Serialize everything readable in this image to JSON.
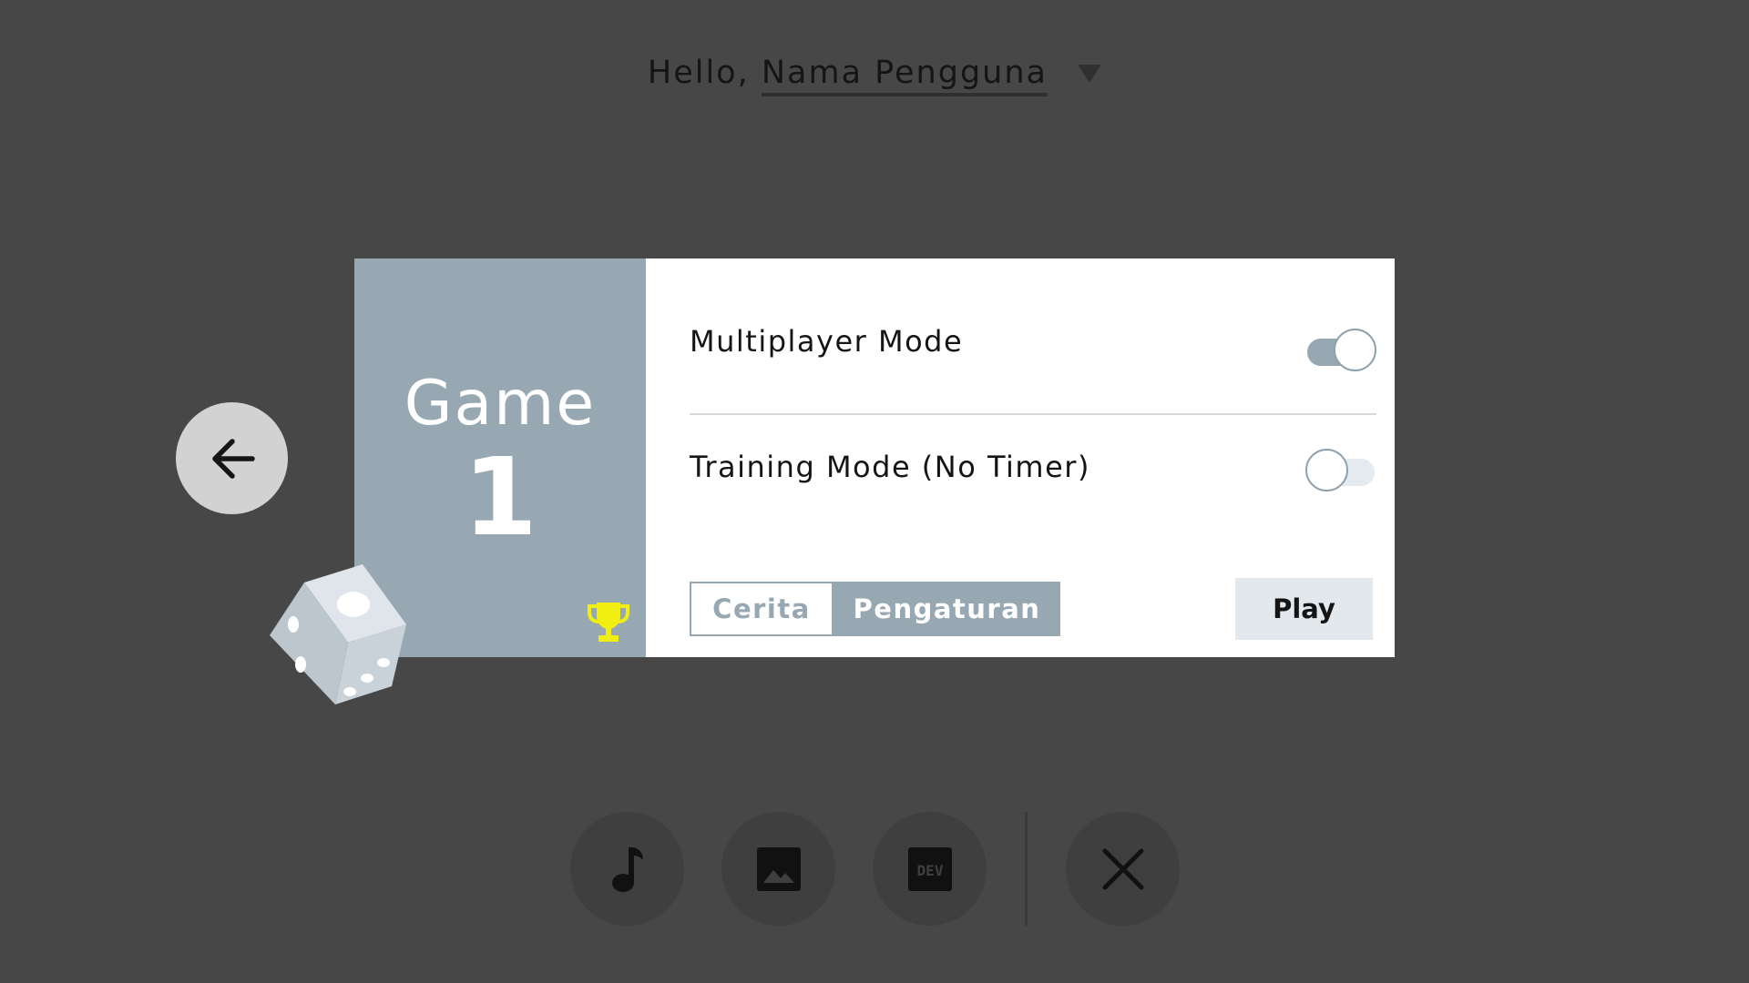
{
  "header": {
    "greeting_prefix": "Hello,",
    "username": "Nama Pengguna"
  },
  "game_card": {
    "title": "Game",
    "number": "1",
    "settings": [
      {
        "label": "Multiplayer Mode",
        "enabled": true
      },
      {
        "label": "Training Mode (No Timer)",
        "enabled": false
      }
    ],
    "tabs": [
      {
        "label": "Cerita",
        "active": false
      },
      {
        "label": "Pengaturan",
        "active": true
      }
    ],
    "play_label": "Play"
  },
  "icons": {
    "back": "arrow-left-icon",
    "dice": "dice-icon",
    "trophy": "trophy-icon",
    "music": "music-note-icon",
    "image": "image-icon",
    "dev": "dev-icon",
    "close": "close-icon"
  },
  "colors": {
    "background": "#474747",
    "card_accent": "#98a8b3",
    "trophy": "#f2ee12"
  },
  "bottom_bar": {
    "dev_label": "DEV"
  }
}
